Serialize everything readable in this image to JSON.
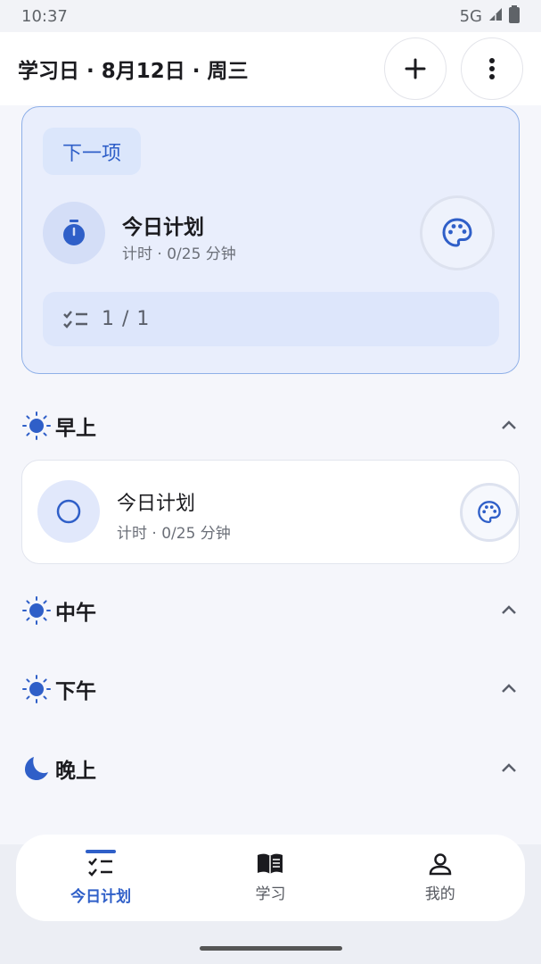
{
  "status_bar": {
    "time": "10:37",
    "network": "5G"
  },
  "header": {
    "title": "学习日 · 8月12日 · 周三"
  },
  "next_card": {
    "badge": "下一项",
    "task_title": "今日计划",
    "task_sub": "计时 · 0/25 分钟",
    "progress": "1 / 1"
  },
  "sections": {
    "morning": "早上",
    "noon": "中午",
    "afternoon": "下午",
    "evening": "晚上"
  },
  "morning_task": {
    "title": "今日计划",
    "sub": "计时 · 0/25 分钟"
  },
  "bottom_nav": {
    "today": "今日计划",
    "study": "学习",
    "mine": "我的"
  },
  "colors": {
    "accent": "#2f5fc8",
    "card_bg": "#e9eefc",
    "card_border": "#8fb0e8"
  }
}
